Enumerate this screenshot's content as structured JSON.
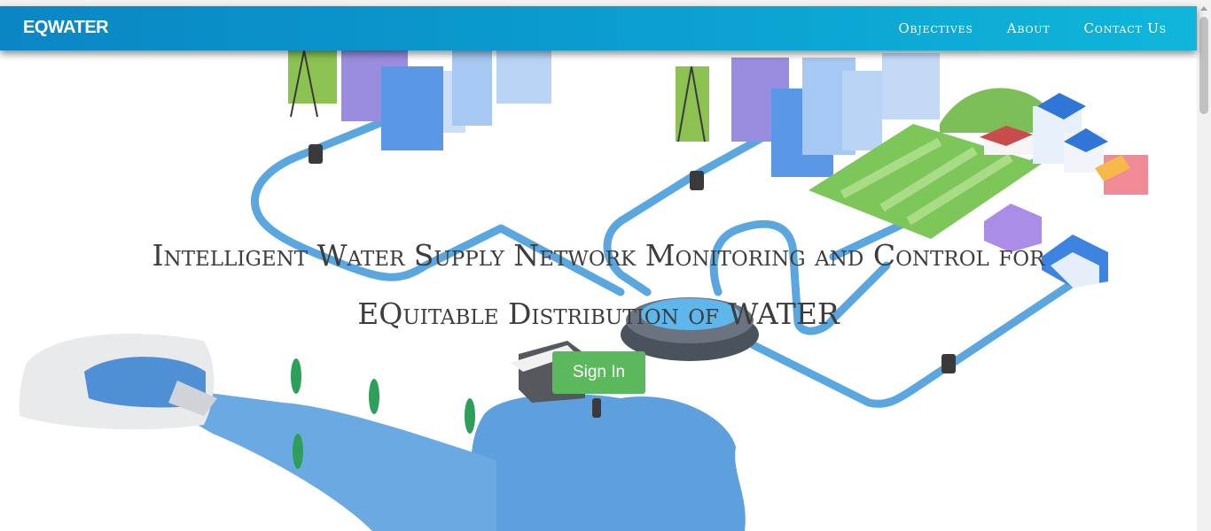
{
  "navbar": {
    "brand": "EQWATER",
    "links": [
      "Objectives",
      "About",
      "Contact Us"
    ]
  },
  "hero": {
    "title_line1": "Intelligent Water Supply Network Monitoring and Control for",
    "title_line2": "EQuitable Distribution of WATER",
    "signin_label": "Sign In"
  },
  "colors": {
    "navbar_start": "#0a86c4",
    "navbar_end": "#0fb6da",
    "pipe": "#5aa7e0",
    "water": "#5e9fde",
    "signin": "#5cb85c"
  }
}
